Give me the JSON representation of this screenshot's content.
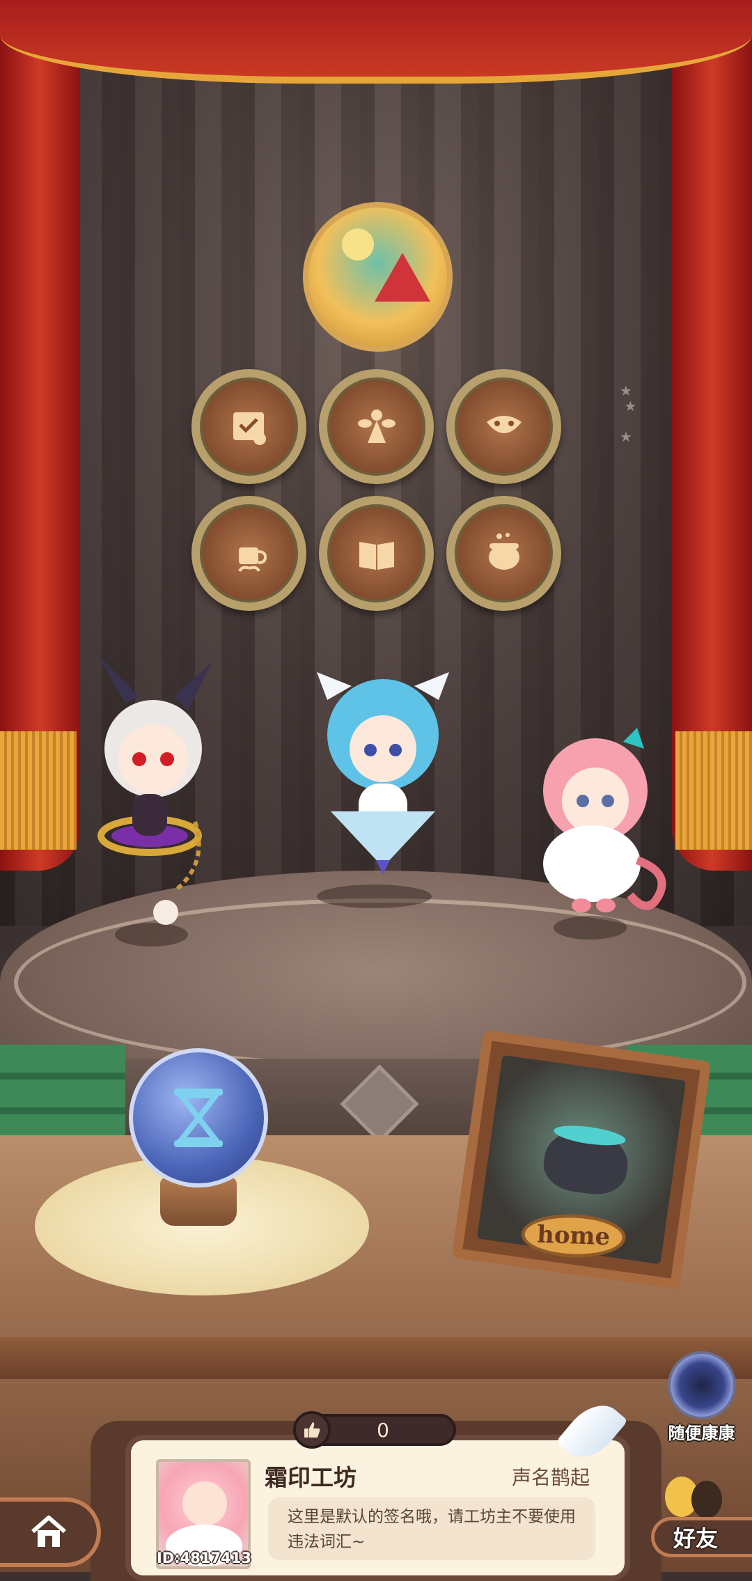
{
  "badges": {
    "featured": {
      "icon": "watermelon-summer-badge"
    },
    "row1": [
      {
        "icon": "certificate-scroll-icon"
      },
      {
        "icon": "fairy-silhouette-icon"
      },
      {
        "icon": "ornate-mask-icon"
      }
    ],
    "row2": [
      {
        "icon": "sprout-cup-icon"
      },
      {
        "icon": "open-book-icon"
      },
      {
        "icon": "cauldron-icon"
      }
    ]
  },
  "characters": [
    {
      "name": "bunny-eared-white-haired-girl"
    },
    {
      "name": "blue-haired-cat-eared-girl"
    },
    {
      "name": "pink-haired-fluffy-girl"
    }
  ],
  "hourglass": {
    "icon": "hourglass-icon"
  },
  "home_frame": {
    "label": "home"
  },
  "random_visit": {
    "label": "随便康康"
  },
  "likes": {
    "count": "0",
    "icon": "thumbs-up-icon"
  },
  "profile": {
    "workshop_name": "霜印工坊",
    "reputation": "声名鹊起",
    "signature": "这里是默认的签名哦，请工坊主不要使用违法词汇~",
    "player_id": "ID:4817413"
  },
  "nav": {
    "home_icon": "house-icon",
    "friends_label": "好友"
  },
  "colors": {
    "curtain": "#c93a24",
    "stage": "#8b7169",
    "badge_rim": "#b7a06b",
    "card_bg": "#fbf2df"
  }
}
